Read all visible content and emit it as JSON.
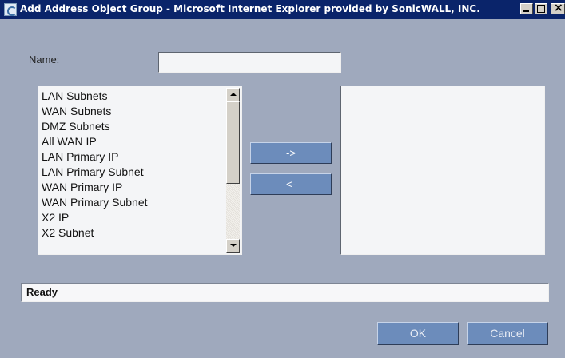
{
  "window": {
    "title": "Add Address Object Group - Microsoft Internet Explorer provided by SonicWALL, INC."
  },
  "form": {
    "name_label": "Name:",
    "name_value": ""
  },
  "available_list": {
    "items": [
      "LAN Subnets",
      "WAN Subnets",
      "DMZ Subnets",
      "All WAN IP",
      "LAN Primary IP",
      "LAN Primary Subnet",
      "WAN Primary IP",
      "WAN Primary Subnet",
      "X2 IP",
      "X2 Subnet"
    ]
  },
  "selected_list": {
    "items": []
  },
  "buttons": {
    "add": "->",
    "remove": "<-",
    "ok": "OK",
    "cancel": "Cancel"
  },
  "status": {
    "text": "Ready"
  },
  "colors": {
    "background": "#9fa9bd",
    "titlebar": "#0a246a",
    "button": "#6c8cbb"
  }
}
